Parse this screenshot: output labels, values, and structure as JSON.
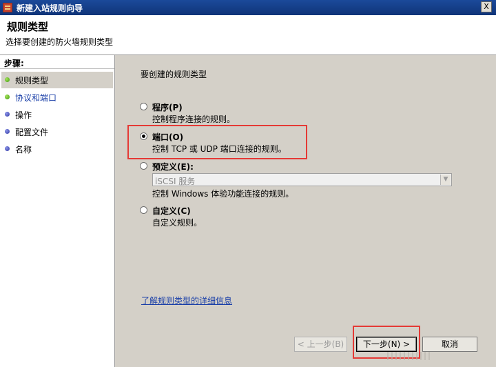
{
  "window": {
    "title": "新建入站规则向导",
    "close_label": "X"
  },
  "header": {
    "title": "规则类型",
    "subtitle": "选择要创建的防火墙规则类型"
  },
  "sidebar": {
    "heading": "步骤:",
    "items": [
      {
        "label": "规则类型",
        "state": "current"
      },
      {
        "label": "协议和端口",
        "state": "next"
      },
      {
        "label": "操作",
        "state": "pending"
      },
      {
        "label": "配置文件",
        "state": "pending"
      },
      {
        "label": "名称",
        "state": "pending"
      }
    ]
  },
  "main": {
    "prompt": "要创建的规则类型",
    "options": [
      {
        "label": "程序(P)",
        "desc": "控制程序连接的规则。",
        "checked": false
      },
      {
        "label": "端口(O)",
        "desc": "控制 TCP 或 UDP 端口连接的规则。",
        "checked": true
      },
      {
        "label": "预定义(E):",
        "desc": "控制 Windows 体验功能连接的规则。",
        "checked": false,
        "combo_value": "iSCSI 服务"
      },
      {
        "label": "自定义(C)",
        "desc": "自定义规则。",
        "checked": false
      }
    ],
    "learn_more": "了解规则类型的详细信息"
  },
  "buttons": {
    "back": "< 上一步(B)",
    "next": "下一步(N) >",
    "cancel": "取消"
  },
  "colors": {
    "highlight_box": "#e53935",
    "title_bar": "#0f3478",
    "link": "#1a3fa8",
    "step_done": "#3c9a0f",
    "step_pending": "#2f37a3"
  },
  "icons": {
    "app": "firewall-icon",
    "current_step": "green-dot-icon",
    "next_step": "green-dot-icon",
    "pending_step": "blue-dot-icon",
    "dropdown": "chevron-down-icon"
  }
}
